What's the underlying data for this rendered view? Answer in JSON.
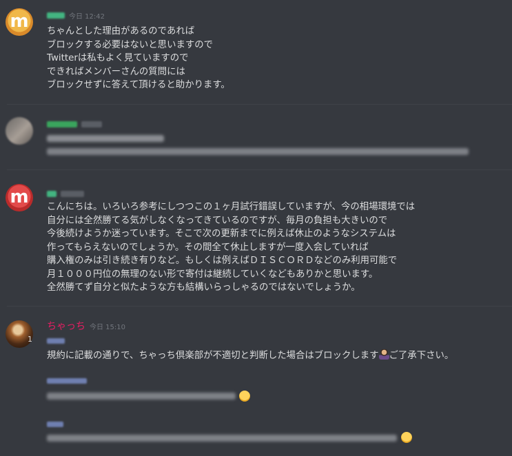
{
  "messages": [
    {
      "author": "",
      "time": "今日 12:42",
      "lines": [
        "ちゃんとした理由があるのであれば",
        "ブロックする必要はないと思いますので",
        "Twitterは私もよく見ていますので",
        "できればメンバーさんの質問には",
        "ブロックせずに答えて頂けると助かります。"
      ]
    },
    {
      "author": "",
      "time": "",
      "lines": []
    },
    {
      "author": "",
      "time": "",
      "lines": [
        "こんにちは。いろいろ参考にしつつこの１ヶ月試行錯誤していますが、今の相場環境では",
        "自分には全然勝てる気がしなくなってきているのですが、毎月の負担も大きいので",
        "今後続けようか迷っています。そこで次の更新までに例えば休止のようなシステムは",
        "作ってもらえないのでしょうか。その間全て休止しますが一度入会していれば",
        "購入権のみは引き続き有りなど。もしくは例えばＤＩＳＣＯＲＤなどのみ利用可能で",
        "月１０００円位の無理のない形で寄付は継続していくなどもありかと思います。",
        "全然勝てず自分と似たような方も結構いらっしゃるのではないでしょうか。"
      ]
    },
    {
      "author": "ちゃっち",
      "time": "今日 15:10",
      "avatar_badge": "1",
      "line1": "規約に記載の通りで、ちゃっち倶楽部が不適切と判断した場合はブロックします",
      "line1_suffix": "ご了承下さい。"
    }
  ],
  "colors": {
    "background": "#36393f",
    "text": "#dcddde",
    "timestamp": "#72767d",
    "author_pink": "#e91e63",
    "author_green": "#43b581"
  },
  "icons": [
    "avatar-orange-m",
    "avatar-red-m",
    "person-bowing-emoji",
    "smile-emoji"
  ]
}
